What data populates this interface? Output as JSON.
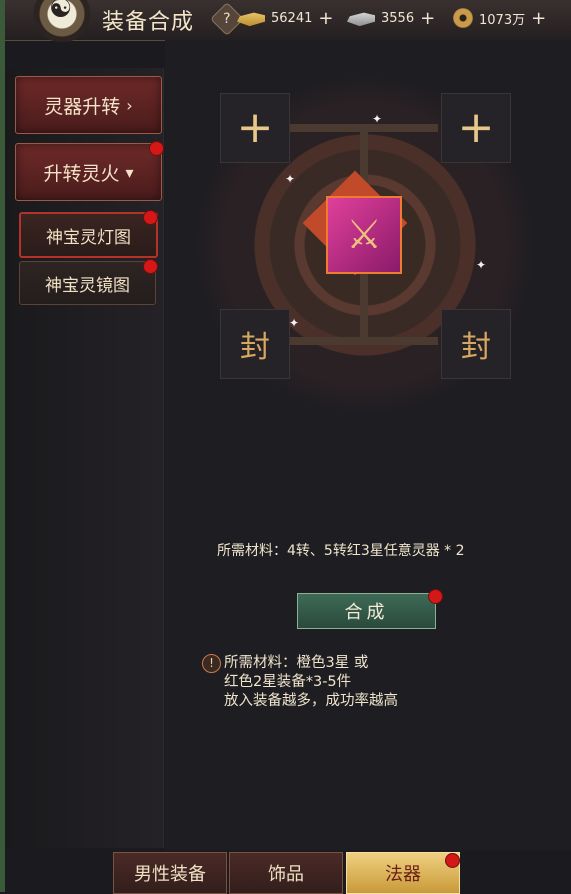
{
  "header": {
    "title": "装备合成",
    "help": "?",
    "currencies": [
      {
        "icon": "gold-ingot-icon",
        "value": "56241",
        "plus": "+"
      },
      {
        "icon": "silver-ingot-icon",
        "value": "3556",
        "plus": "+"
      },
      {
        "icon": "copper-coin-icon",
        "value": "1073万",
        "plus": "+"
      }
    ]
  },
  "sidebar": {
    "tabs": [
      {
        "label": "灵器升转",
        "arrow": "›"
      },
      {
        "label": "升转灵火",
        "arrow": "▾"
      }
    ],
    "subitems": [
      {
        "label": "神宝灵灯图"
      },
      {
        "label": "神宝灵镜图"
      }
    ]
  },
  "synthesis": {
    "slot_plus": "+",
    "seal_glyph": "封",
    "item_glyph": "⚔",
    "requirement": "所需材料：4转、5转红3星任意灵器 * 2",
    "compose_label": "合成",
    "warn_icon": "!",
    "note_lines": [
      "所需材料：橙色3星 或",
      "红色2星装备*3-5件",
      "放入装备越多，成功率越高"
    ]
  },
  "bottom_tabs": [
    {
      "label": "男性装备"
    },
    {
      "label": "饰品"
    },
    {
      "label": "法器"
    }
  ],
  "colors": {
    "accent_red": "#d41818",
    "compose_green": "#2a4a3c",
    "active_tab_gold": "#c89a3a"
  }
}
